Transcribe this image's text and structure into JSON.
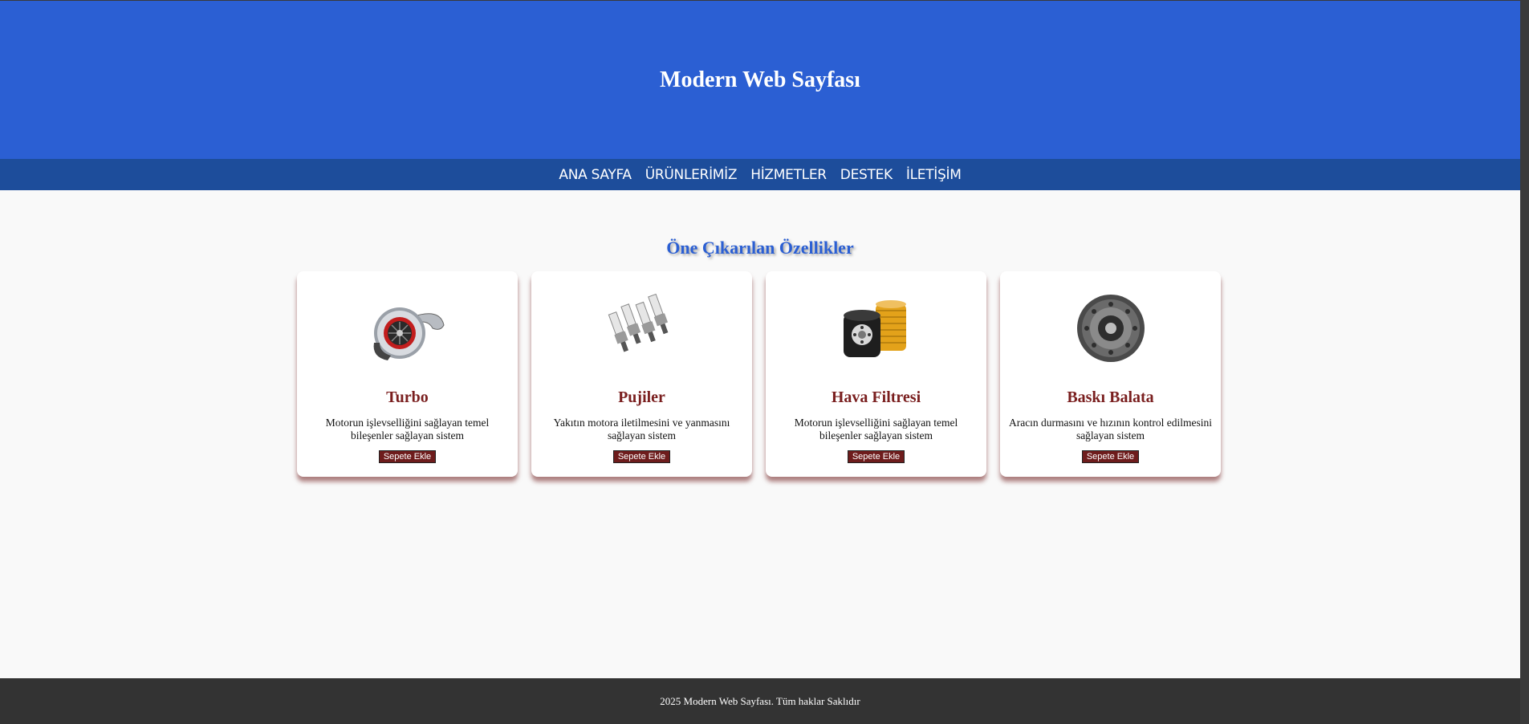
{
  "header": {
    "title": "Modern Web Sayfası"
  },
  "nav": {
    "items": [
      {
        "label": "ANA SAYFA"
      },
      {
        "label": "ÜRÜNLERİMİZ"
      },
      {
        "label": "HİZMETLER"
      },
      {
        "label": "DESTEK"
      },
      {
        "label": "İLETİŞİM"
      }
    ]
  },
  "features": {
    "title": "Öne Çıkarılan Özellikler",
    "cards": [
      {
        "icon": "turbo-icon",
        "title": "Turbo",
        "description": "Motorun işlevselliğini sağlayan temel bileşenler sağlayan sistem",
        "button": "Sepete Ekle"
      },
      {
        "icon": "spark-plugs-icon",
        "title": "Pujiler",
        "description": "Yakıtın motora iletilmesini ve yanmasını sağlayan sistem",
        "button": "Sepete Ekle"
      },
      {
        "icon": "air-filter-icon",
        "title": "Hava Filtresi",
        "description": "Motorun işlevselliğini sağlayan temel bileşenler sağlayan sistem",
        "button": "Sepete Ekle"
      },
      {
        "icon": "clutch-disc-icon",
        "title": "Baskı Balata",
        "description": "Aracın durmasını ve hızının kontrol edilmesini sağlayan sistem",
        "button": "Sepete Ekle"
      }
    ]
  },
  "footer": {
    "text": "2025 Modern Web Sayfası. Tüm haklar Saklıdır"
  },
  "colors": {
    "header_bg": "#2b5fd3",
    "nav_bg": "#1d4d9b",
    "accent_title": "#2b5fd3",
    "card_title": "#7a1f1f",
    "button_bg": "#6e1c1c",
    "footer_bg": "#333333"
  }
}
